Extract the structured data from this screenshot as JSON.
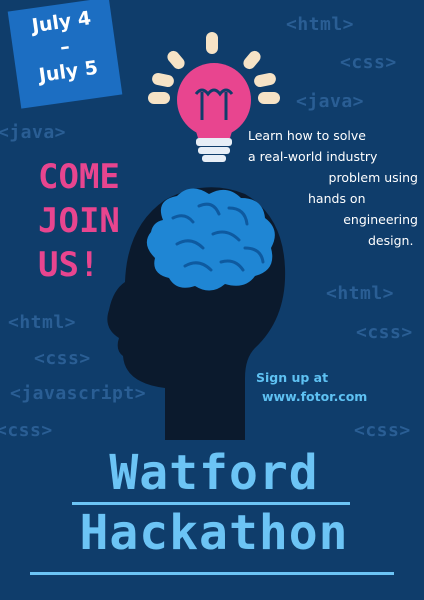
{
  "dates": {
    "line1": "July 4",
    "line2": "–",
    "line3": "July 5"
  },
  "headline": {
    "line1": "COME",
    "line2": "JOIN",
    "line3": "US!"
  },
  "description": {
    "line1": "Learn how to solve",
    "line2": "a real-world industry",
    "line3": "problem using",
    "line4": "hands on",
    "line5": "engineering",
    "line6": "design."
  },
  "signup": {
    "line1": "Sign up at",
    "line2": "www.fotor.com"
  },
  "title": {
    "line1": "Watford",
    "line2": "Hackathon"
  },
  "background_tags": [
    "<html>",
    "<css>",
    "<java>",
    "<java>",
    "<html>",
    "<css>",
    "<html>",
    "<css>",
    "<javascript>",
    "<css>",
    "<css>"
  ],
  "colors": {
    "background": "#0f3d6b",
    "date_box": "#1c6ec2",
    "headline": "#e8458f",
    "bulb": "#e8458f",
    "bulb_rays": "#f6e3c6",
    "brain": "#1f86d4",
    "head": "#0b1a2d",
    "title": "#6cc4f5",
    "tag_text": "#2a5e94"
  },
  "icons": {
    "bulb": "lightbulb-icon",
    "head": "head-silhouette-icon",
    "brain": "brain-icon"
  }
}
